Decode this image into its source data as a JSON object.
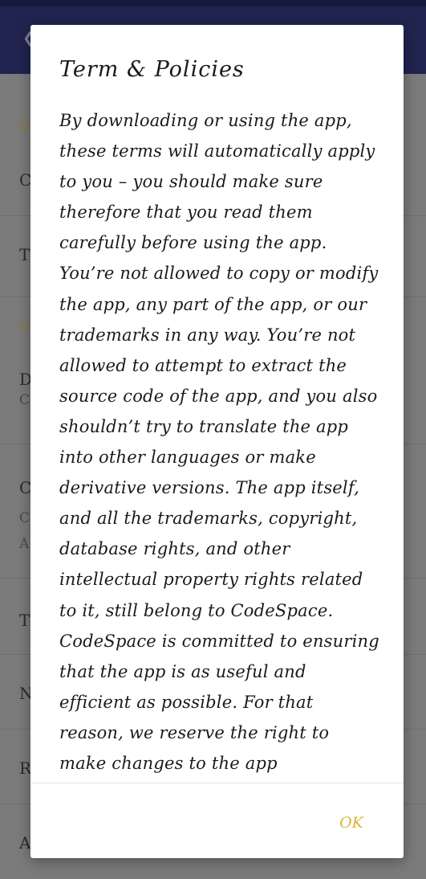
{
  "background": {
    "row_letters": [
      "D",
      "C",
      "T",
      "O",
      "D",
      "C",
      "C",
      "C",
      "A",
      "T",
      "N",
      "R",
      "A"
    ]
  },
  "dialog": {
    "title": "Term & Policies",
    "body": "By downloading or using the app, these terms will automatically apply to you – you should make sure therefore that you read them carefully before using the app. You’re not allowed to copy or modify the app, any part of the app, or our trademarks in any way. You’re not allowed to attempt to extract the source code of the app, and you also shouldn’t try to translate the app into other languages or make derivative versions. The app itself, and all the trademarks, copyright, database rights, and other intellectual property rights related to it, still belong to CodeSpace. CodeSpace is committed to ensuring that the app is as useful and efficient as possible. For that reason, we reserve the right to make changes to the app",
    "ok_label": "OK"
  },
  "colors": {
    "app_bar": "#20244f",
    "scrim_background": "#7b7b7b",
    "dialog_background": "#ffffff",
    "accent": "#d9b73a"
  }
}
